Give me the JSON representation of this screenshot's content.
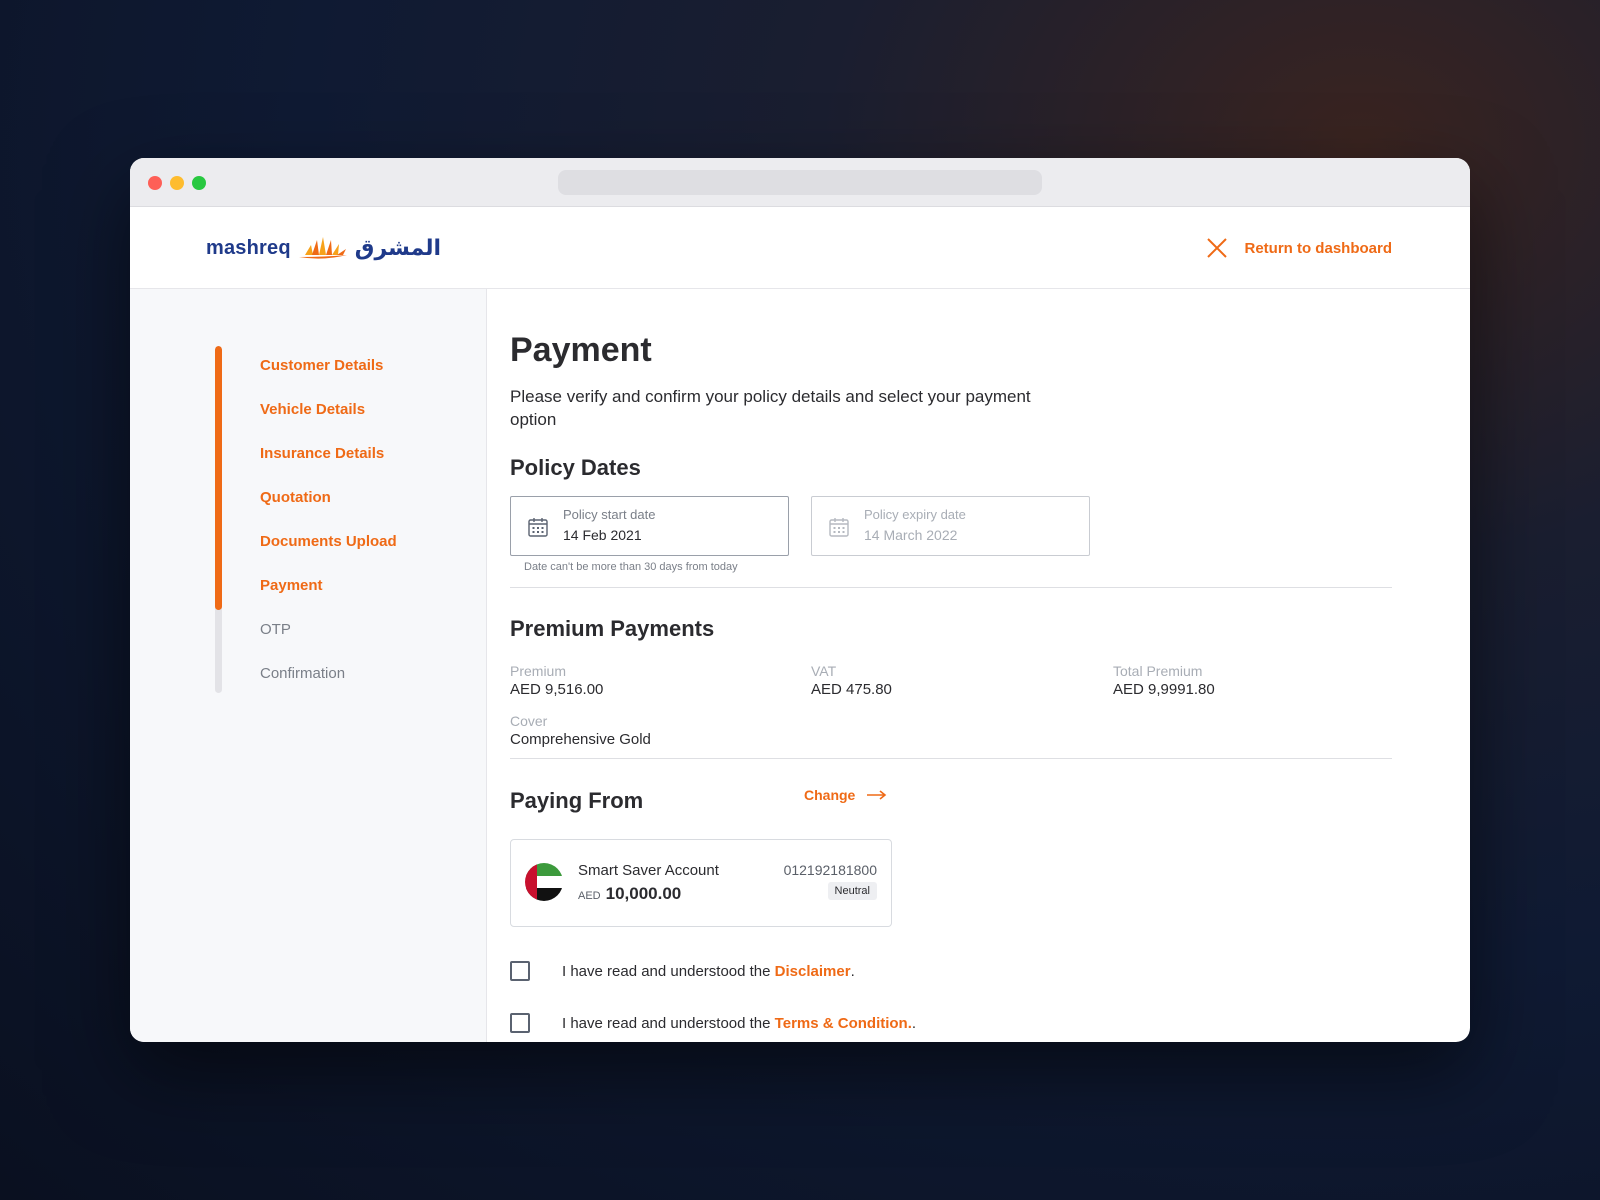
{
  "brand": {
    "name_en": "mashreq",
    "name_ar": "المشرق"
  },
  "header": {
    "return_label": "Return to dashboard"
  },
  "sidebar": {
    "progress_fraction": 0.76,
    "steps": [
      {
        "label": "Customer Details",
        "state": "done"
      },
      {
        "label": "Vehicle Details",
        "state": "done"
      },
      {
        "label": "Insurance Details",
        "state": "done"
      },
      {
        "label": "Quotation",
        "state": "done"
      },
      {
        "label": "Documents Upload",
        "state": "done"
      },
      {
        "label": "Payment",
        "state": "current"
      },
      {
        "label": "OTP",
        "state": "todo"
      },
      {
        "label": "Confirmation",
        "state": "todo"
      }
    ]
  },
  "page": {
    "title": "Payment",
    "subtitle": "Please verify and confirm your policy details and select your payment option"
  },
  "policy_dates": {
    "title": "Policy Dates",
    "start": {
      "label": "Policy start date",
      "value": "14 Feb 2021"
    },
    "expiry": {
      "label": "Policy expiry date",
      "value": "14 March 2022"
    },
    "hint": "Date can't be more than 30 days from today"
  },
  "premium": {
    "title": "Premium Payments",
    "premium_label": "Premium",
    "premium_value": "AED 9,516.00",
    "vat_label": "VAT",
    "vat_value": "AED 475.80",
    "total_label": "Total Premium",
    "total_value": "AED 9,9991.80",
    "cover_label": "Cover",
    "cover_value": "Comprehensive Gold"
  },
  "paying_from": {
    "title": "Paying From",
    "change_label": "Change",
    "account": {
      "name": "Smart Saver Account",
      "currency": "AED",
      "balance": "10,000.00",
      "number": "012192181800",
      "badge": "Neutral"
    }
  },
  "agreements": {
    "prefix": "I have read and understood the ",
    "disclaimer_link": "Disclaimer",
    "disclaimer_suffix": ".",
    "terms_link": "Terms & Condition.",
    "terms_suffix": "."
  },
  "colors": {
    "accent": "#ef6a16",
    "brand_blue": "#1f3a8a",
    "text": "#2b2b2f",
    "muted": "#7a7f88"
  }
}
